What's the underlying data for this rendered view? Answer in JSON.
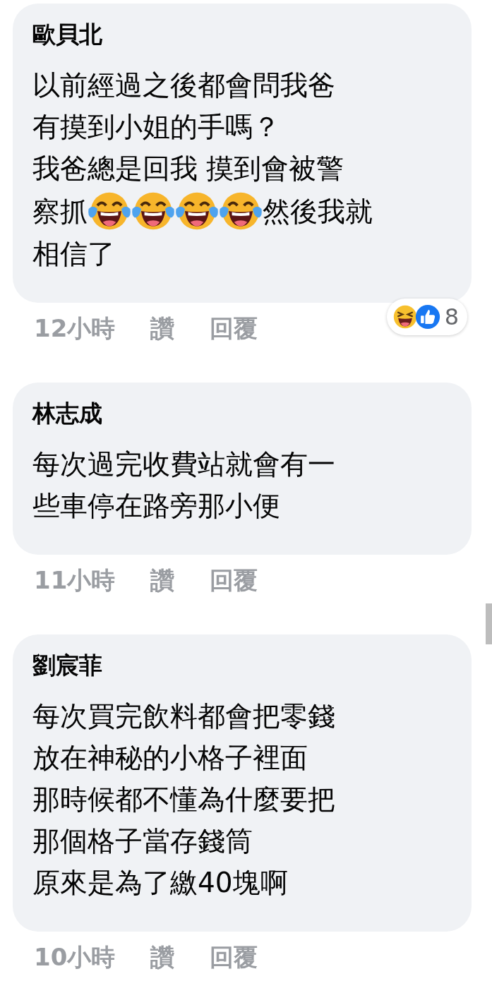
{
  "comments": [
    {
      "author": "歐貝北",
      "lines": [
        [
          {
            "kind": "text",
            "text": "以前經過之後都會問我爸"
          }
        ],
        [
          {
            "kind": "text",
            "text": "有摸到小姐的手嗎？"
          }
        ],
        [
          {
            "kind": "text",
            "text": "我爸總是回我 摸到會被警"
          }
        ],
        [
          {
            "kind": "text",
            "text": "察抓"
          },
          {
            "kind": "emoji"
          },
          {
            "kind": "emoji"
          },
          {
            "kind": "emoji"
          },
          {
            "kind": "emoji"
          },
          {
            "kind": "text",
            "text": "然後我就"
          }
        ],
        [
          {
            "kind": "text",
            "text": "相信了"
          }
        ]
      ],
      "time": "12小時",
      "like": "讚",
      "reply": "回覆",
      "reactions": {
        "count": "8"
      }
    },
    {
      "author": "林志成",
      "lines": [
        [
          {
            "kind": "text",
            "text": "每次過完收費站就會有一"
          }
        ],
        [
          {
            "kind": "text",
            "text": "些車停在路旁那小便"
          }
        ]
      ],
      "time": "11小時",
      "like": "讚",
      "reply": "回覆"
    },
    {
      "author": "劉宸菲",
      "lines": [
        [
          {
            "kind": "text",
            "text": "每次買完飲料都會把零錢"
          }
        ],
        [
          {
            "kind": "text",
            "text": "放在神秘的小格子裡面"
          }
        ],
        [
          {
            "kind": "text",
            "text": "那時候都不懂為什麼要把"
          }
        ],
        [
          {
            "kind": "text",
            "text": "那個格子當存錢筒"
          }
        ],
        [
          {
            "kind": "text",
            "text": "原來是為了繳40塊啊"
          }
        ]
      ],
      "time": "10小時",
      "like": "讚",
      "reply": "回覆"
    }
  ]
}
